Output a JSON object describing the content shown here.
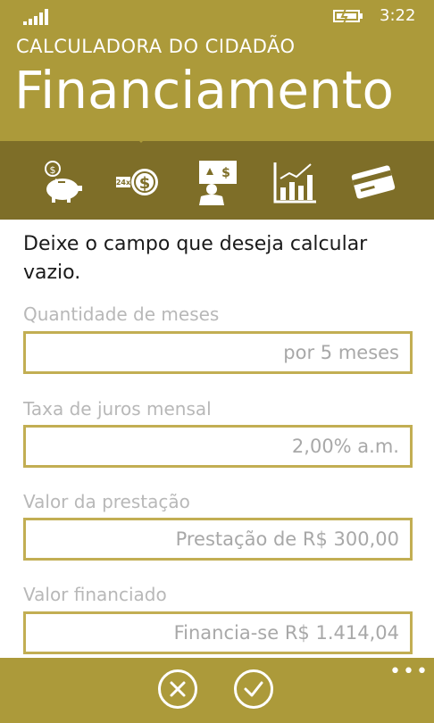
{
  "status": {
    "time": "3:22"
  },
  "header": {
    "app_title": "CALCULADORA DO CIDADÃO",
    "page_title": "Financiamento"
  },
  "tabs": [
    {
      "icon": "piggy-bank-icon",
      "label": ""
    },
    {
      "icon": "installments-icon",
      "label": ""
    },
    {
      "icon": "presentation-icon",
      "label": ""
    },
    {
      "icon": "bar-chart-icon",
      "label": ""
    },
    {
      "icon": "credit-card-icon",
      "label": ""
    }
  ],
  "instruction": "Deixe o campo que deseja calcular vazio.",
  "fields": [
    {
      "label": "Quantidade de meses",
      "placeholder": "por 5 meses"
    },
    {
      "label": "Taxa de juros mensal",
      "placeholder": "2,00% a.m."
    },
    {
      "label": "Valor da prestação",
      "placeholder": "Prestação de R$ 300,00"
    },
    {
      "label": "Valor financiado",
      "placeholder": "Financia-se R$ 1.414,04"
    }
  ],
  "appbar": {
    "more": "•••"
  },
  "colors": {
    "header": "#ac9a3a",
    "tabbar": "#7e6e28",
    "field_border": "#c2ae53"
  }
}
